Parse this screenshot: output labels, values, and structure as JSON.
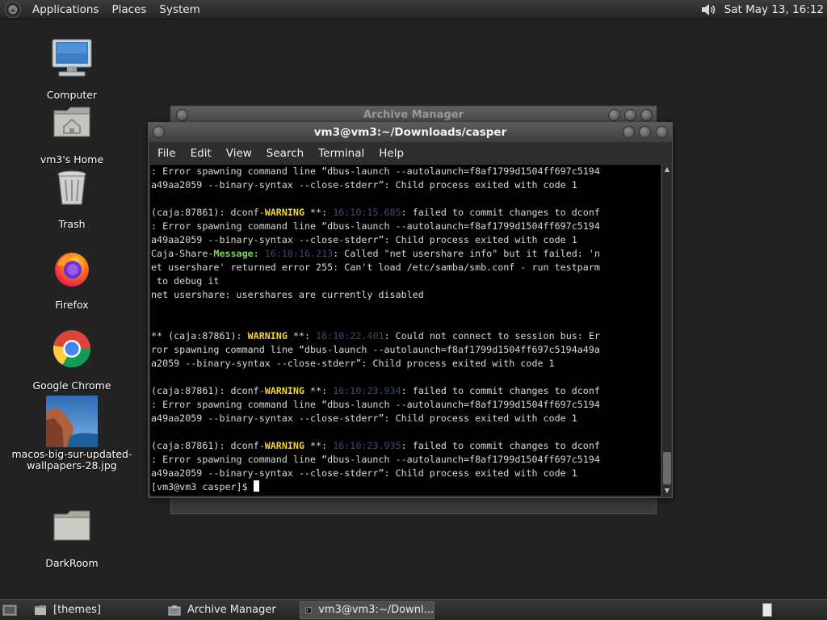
{
  "top_panel": {
    "menus": [
      "Applications",
      "Places",
      "System"
    ],
    "clock": "Sat May 13, 16:12"
  },
  "desktop": {
    "icons": [
      {
        "label": "Computer"
      },
      {
        "label": "vm3's Home"
      },
      {
        "label": "Trash"
      },
      {
        "label": "Firefox"
      },
      {
        "label": "Google Chrome"
      },
      {
        "label": "macos-big-sur-updated-wallpapers-28.jpg"
      },
      {
        "label": "DarkRoom"
      }
    ]
  },
  "back_window": {
    "title": "Archive Manager"
  },
  "terminal_window": {
    "title": "vm3@vm3:~/Downloads/casper",
    "menu": [
      "File",
      "Edit",
      "View",
      "Search",
      "Terminal",
      "Help"
    ],
    "lines": [
      [
        {
          "t": ": Error spawning command line “dbus-launch --autolaunch=f8af1799d1504ff697c5194"
        }
      ],
      [
        {
          "t": "a49aa2059 --binary-syntax --close-stderr”: Child process exited with code 1"
        }
      ],
      [
        {
          "t": ""
        }
      ],
      [
        {
          "t": "(caja:87861): dconf-"
        },
        {
          "t": "WARNING",
          "c": "warn"
        },
        {
          "t": " **: "
        },
        {
          "t": "16:10:15.685",
          "c": "ts"
        },
        {
          "t": ": failed to commit changes to dconf"
        }
      ],
      [
        {
          "t": ": Error spawning command line “dbus-launch --autolaunch=f8af1799d1504ff697c5194"
        }
      ],
      [
        {
          "t": "a49aa2059 --binary-syntax --close-stderr”: Child process exited with code 1"
        }
      ],
      [
        {
          "t": "Caja-Share-"
        },
        {
          "t": "Message",
          "c": "msg"
        },
        {
          "t": ": "
        },
        {
          "t": "16:10:16.213",
          "c": "ts"
        },
        {
          "t": ": Called \"net usershare info\" but it failed: 'n"
        }
      ],
      [
        {
          "t": "et usershare' returned error 255: Can't load /etc/samba/smb.conf - run testparm"
        }
      ],
      [
        {
          "t": " to debug it"
        }
      ],
      [
        {
          "t": "net usershare: usershares are currently disabled"
        }
      ],
      [
        {
          "t": ""
        }
      ],
      [
        {
          "t": ""
        }
      ],
      [
        {
          "t": "** (caja:87861): "
        },
        {
          "t": "WARNING",
          "c": "warn"
        },
        {
          "t": " **: "
        },
        {
          "t": "16:10:22.401",
          "c": "ts"
        },
        {
          "t": ": Could not connect to session bus: Er"
        }
      ],
      [
        {
          "t": "ror spawning command line “dbus-launch --autolaunch=f8af1799d1504ff697c5194a49a"
        }
      ],
      [
        {
          "t": "a2059 --binary-syntax --close-stderr”: Child process exited with code 1"
        }
      ],
      [
        {
          "t": ""
        }
      ],
      [
        {
          "t": "(caja:87861): dconf-"
        },
        {
          "t": "WARNING",
          "c": "warn"
        },
        {
          "t": " **: "
        },
        {
          "t": "16:10:23.934",
          "c": "ts"
        },
        {
          "t": ": failed to commit changes to dconf"
        }
      ],
      [
        {
          "t": ": Error spawning command line “dbus-launch --autolaunch=f8af1799d1504ff697c5194"
        }
      ],
      [
        {
          "t": "a49aa2059 --binary-syntax --close-stderr”: Child process exited with code 1"
        }
      ],
      [
        {
          "t": ""
        }
      ],
      [
        {
          "t": "(caja:87861): dconf-"
        },
        {
          "t": "WARNING",
          "c": "warn"
        },
        {
          "t": " **: "
        },
        {
          "t": "16:10:23.935",
          "c": "ts"
        },
        {
          "t": ": failed to commit changes to dconf"
        }
      ],
      [
        {
          "t": ": Error spawning command line “dbus-launch --autolaunch=f8af1799d1504ff697c5194"
        }
      ],
      [
        {
          "t": "a49aa2059 --binary-syntax --close-stderr”: Child process exited with code 1"
        }
      ]
    ],
    "prompt": "[vm3@vm3 casper]$ "
  },
  "taskbar": {
    "items": [
      {
        "label": "[themes]",
        "icon": "folder-icon"
      },
      {
        "label": "Archive Manager",
        "icon": "archive-manager-icon"
      },
      {
        "label": "vm3@vm3:~/Downl...",
        "icon": "terminal-icon"
      }
    ]
  },
  "colors": {
    "desktop_bg": "#232323",
    "warning": "#f2d43a",
    "message": "#7cd35c",
    "timestamp": "#3d4c6b"
  }
}
